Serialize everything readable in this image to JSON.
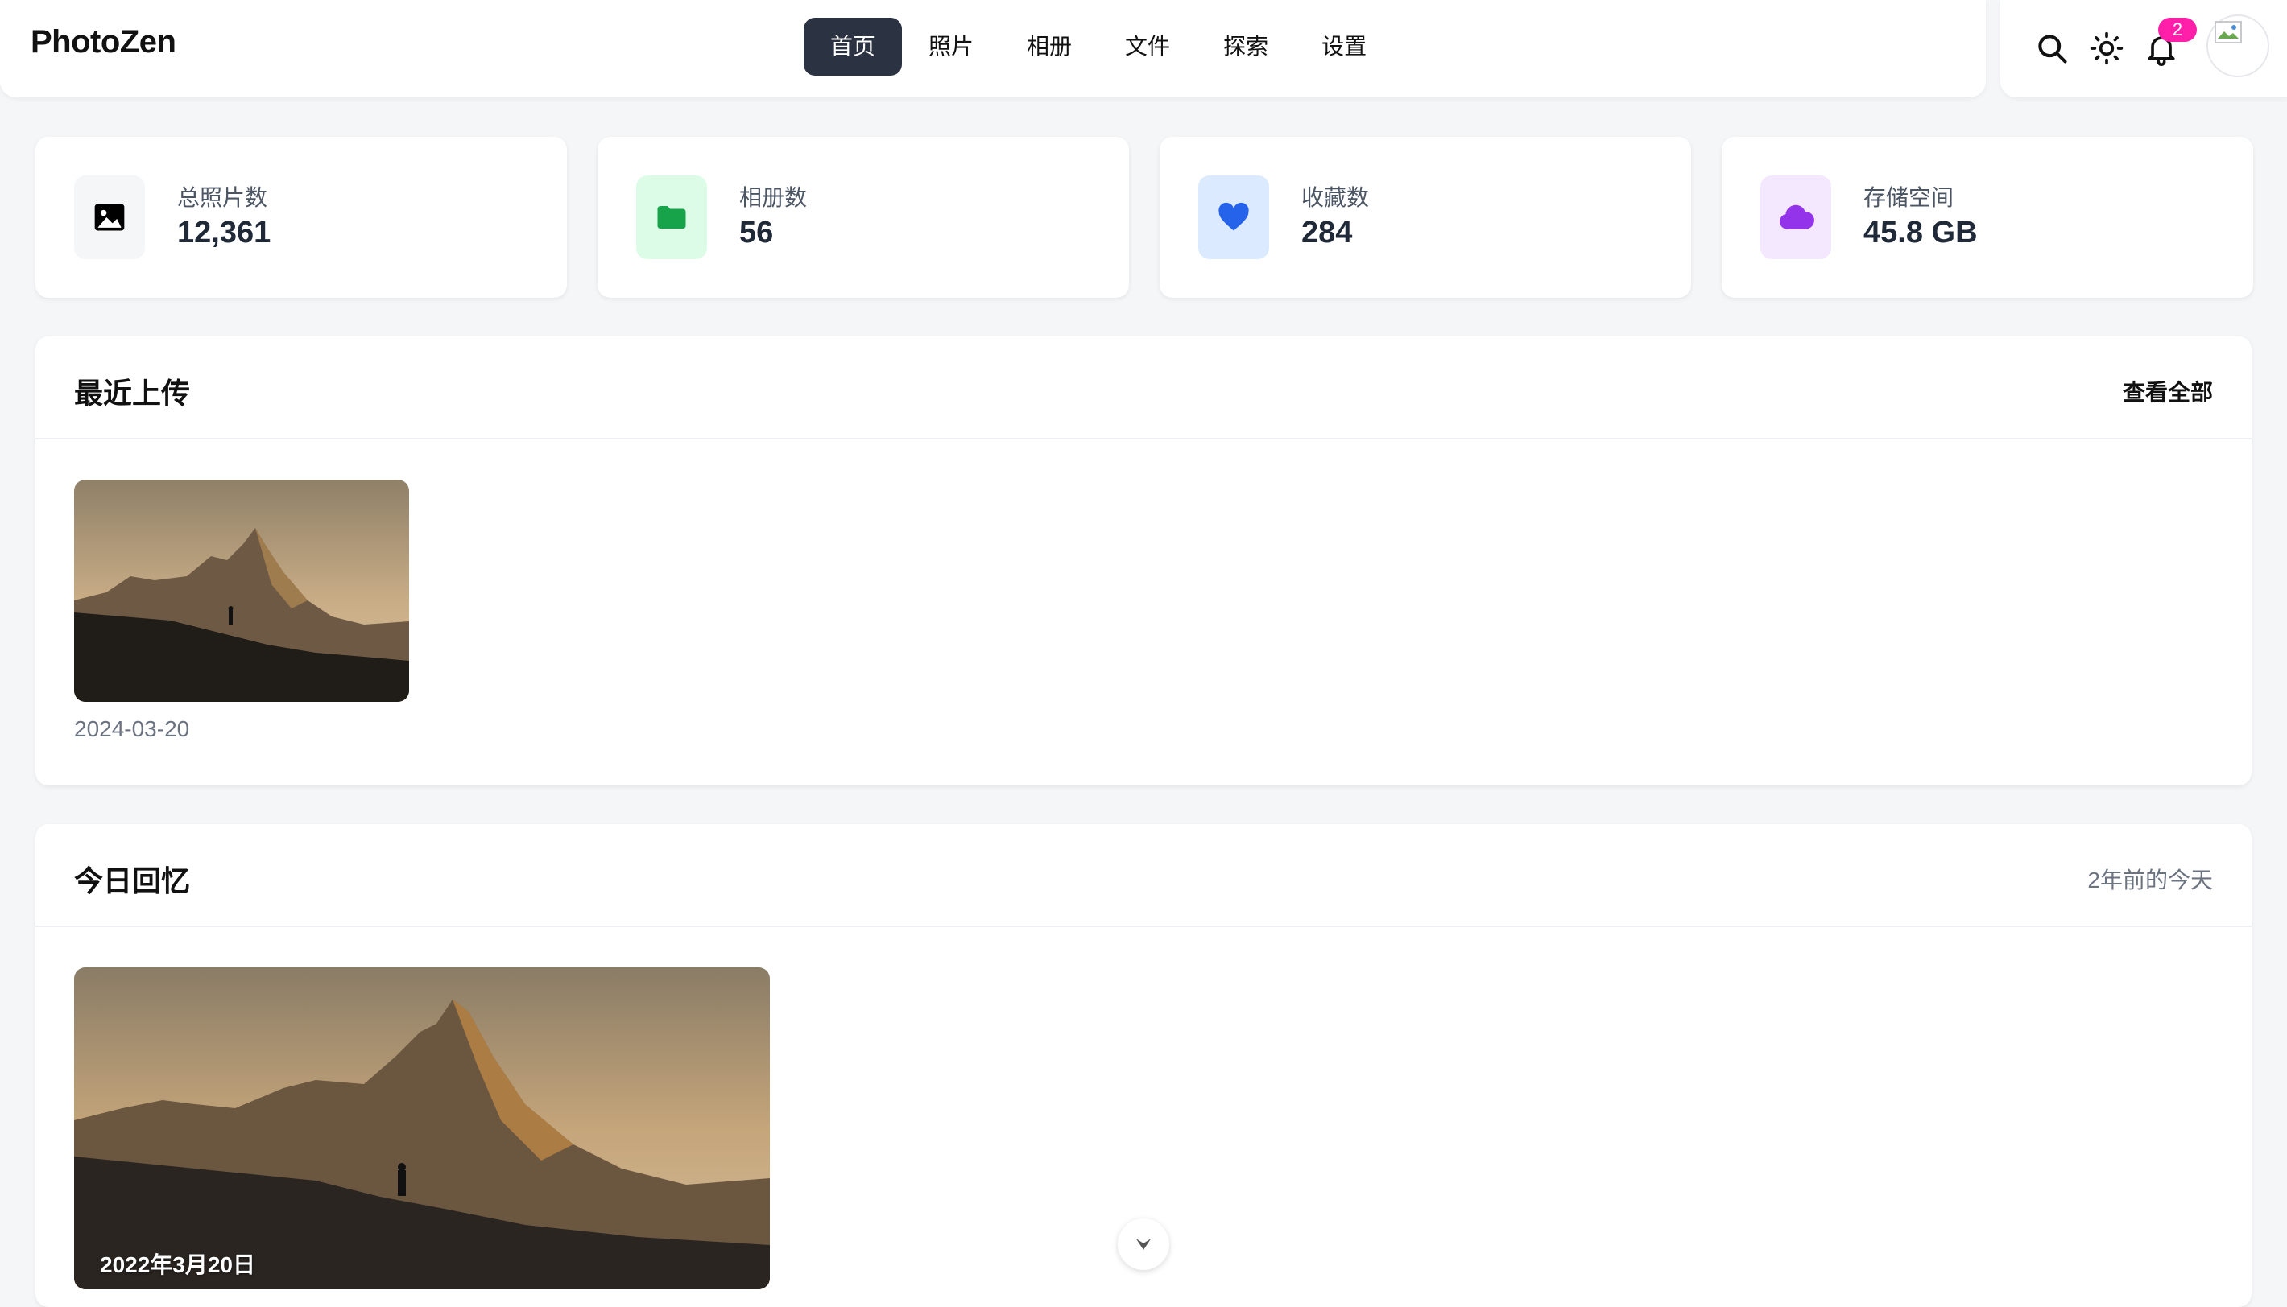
{
  "app": {
    "logo": "PhotoZen"
  },
  "nav": {
    "items": [
      "首页",
      "照片",
      "相册",
      "文件",
      "探索",
      "设置"
    ],
    "active_index": 0
  },
  "header_actions": {
    "search_icon": "search-icon",
    "theme_icon": "sun-icon",
    "bell_icon": "bell-icon",
    "notification_count": "2"
  },
  "stats": [
    {
      "label": "总照片数",
      "value": "12,361",
      "icon": "image-icon",
      "color": "#000000",
      "bg": "#f5f6f8"
    },
    {
      "label": "相册数",
      "value": "56",
      "icon": "folder-icon",
      "color": "#16a34a",
      "bg": "#dcfce7"
    },
    {
      "label": "收藏数",
      "value": "284",
      "icon": "heart-icon",
      "color": "#2563eb",
      "bg": "#dbeafe"
    },
    {
      "label": "存储空间",
      "value": "45.8 GB",
      "icon": "cloud-icon",
      "color": "#9333ea",
      "bg": "#f3e8ff"
    }
  ],
  "recent": {
    "title": "最近上传",
    "view_all": "查看全部",
    "photos": [
      {
        "date": "2024-03-20"
      }
    ]
  },
  "memories": {
    "title": "今日回忆",
    "subtitle": "2年前的今天",
    "photos": [
      {
        "caption": "2022年3月20日"
      }
    ]
  },
  "colors": {
    "accent": "#2b3242",
    "badge": "#ff1fa8",
    "background": "#f5f6f8"
  }
}
